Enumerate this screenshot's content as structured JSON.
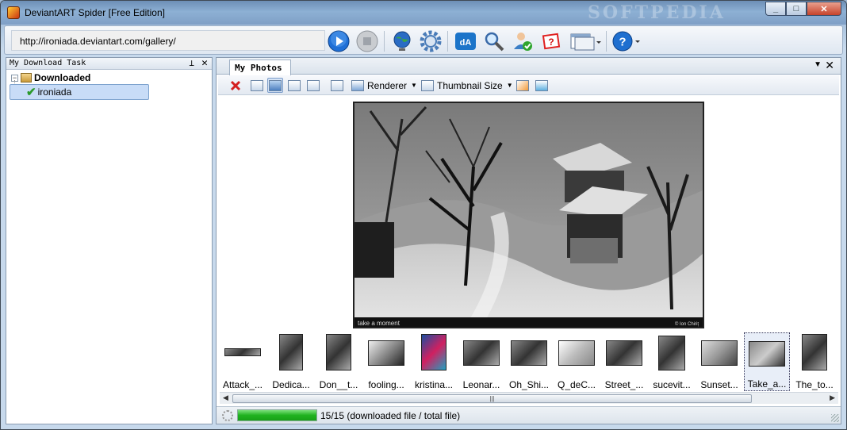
{
  "window": {
    "title": "DeviantART Spider [Free Edition]",
    "watermark": "SOFTPEDIA",
    "minimize": "_",
    "maximize": "□",
    "close": "✕"
  },
  "toolbar": {
    "url": "http://ironiada.deviantart.com/gallery/",
    "icons": [
      "play-icon",
      "stop-icon",
      "globe-icon",
      "gear-icon",
      "deviantart-icon",
      "search-icon",
      "user-check-icon",
      "help-book-icon",
      "window-dropdown-icon",
      "help-icon"
    ]
  },
  "left_panel": {
    "title": "My Download Task",
    "tree": {
      "root_expander": "−",
      "root_label": "Downloaded",
      "child_label": "ironiada"
    }
  },
  "right_panel": {
    "tab_label": "My Photos",
    "toolbar": {
      "renderer_label": "Renderer",
      "thumbnail_size_label": "Thumbnail Size"
    },
    "thumbnails": [
      {
        "caption": "Attack_..."
      },
      {
        "caption": "Dedica..."
      },
      {
        "caption": "Don__t..."
      },
      {
        "caption": "fooling..."
      },
      {
        "caption": "kristina..."
      },
      {
        "caption": "Leonar..."
      },
      {
        "caption": "Oh_Shi..."
      },
      {
        "caption": "Q_deC..."
      },
      {
        "caption": "Street_..."
      },
      {
        "caption": "sucevit..."
      },
      {
        "caption": "Sunset..."
      },
      {
        "caption": "Take_a..."
      },
      {
        "caption": "The_to..."
      }
    ],
    "selected_thumbnail": "Take_a...",
    "photo_caption_left": "take a moment",
    "photo_caption_right": "© Ion Chiriț"
  },
  "status": {
    "progress": 1.0,
    "text": "15/15 (downloaded file / total file)"
  },
  "colors": {
    "progress_green": "#1fb21f",
    "selection_blue": "#c8dcf7"
  }
}
